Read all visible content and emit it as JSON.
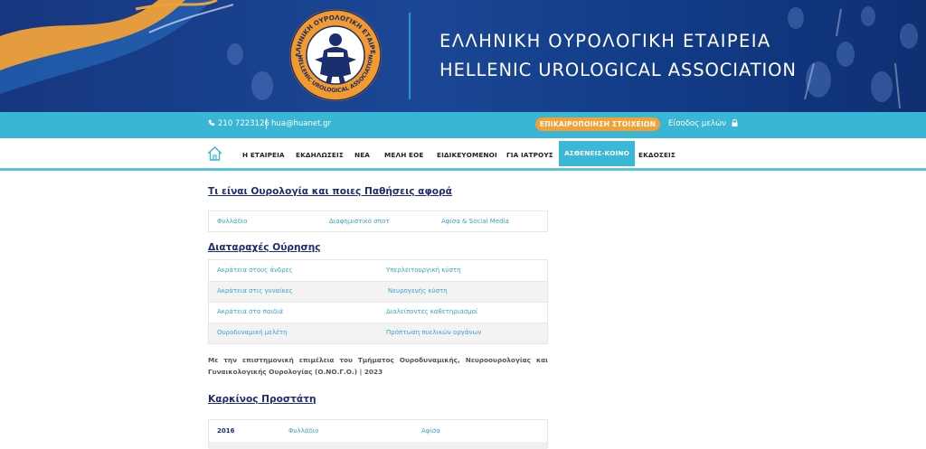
{
  "header": {
    "title_gr": "ΕΛΛΗΝΙΚΗ ΟΥΡΟΛΟΓΙΚΗ ΕΤΑΙΡΕΙΑ",
    "title_en": "HELLENIC UROLOGICAL ASSOCIATION",
    "logo_text_top": "ΕΛΛΗΝΙΚΗ ΟΥΡΟΛΟΓΙΚΗ ΕΤΑΙΡΕΙΑ",
    "logo_text_bottom": "HELLENIC UROLOGICAL ASSOCIATION"
  },
  "topbar": {
    "phone": "210 7223126",
    "email": "hua@huanet.gr",
    "update_button": "ΕΠΙΚΑΙΡΟΠΟΙΗΣΗ ΣΤΟΙΧΕΙΩΝ",
    "login": "Είσοδος μελών"
  },
  "nav": {
    "items": [
      "Η ΕΤΑΙΡΕΙΑ",
      "ΕΚΔΗΛΩΣΕΙΣ",
      "ΝΕΑ",
      "ΜΕΛΗ ΕΟΕ",
      "ΕΙΔΙΚΕΥΟΜΕΝΟΙ",
      "ΓΙΑ ΙΑΤΡΟΥΣ",
      "ΑΣΘΕΝΕΙΣ-ΚΟΙΝΟ",
      "ΕΚΔΟΣΕΙΣ"
    ],
    "active_index": 6
  },
  "section1": {
    "title": "Τι είναι Ουρολογία και ποιες Παθήσεις αφορά",
    "links": [
      "Φυλλάδιο",
      "Διαφημιστικό σποτ",
      "Αφίσα & Social Media"
    ]
  },
  "section2": {
    "title": "Διαταραχές Ούρησης",
    "rows": [
      [
        "Ακράτεια στους άνδρες",
        "Υπερλειτουργική κύστη"
      ],
      [
        "Ακράτεια στις γυναίκες",
        "Νευρογενής κύστη"
      ],
      [
        "Ακράτεια στα παιδιά",
        "Διαλείποντες καθετηριασμοί"
      ],
      [
        "Ουροδυναμική μελέτη",
        "Πρόπτωση πυελικών οργάνων"
      ]
    ],
    "note": "Με την επιστημονική επιμέλεια του Τμήματος Ουροδυναμικής, Νευροουρολογίας και Γυναικολογικής Ουρολογίας (Ο.ΝΟ.Γ.Ο.) | 2023"
  },
  "section3": {
    "title": "Καρκίνος Προστάτη",
    "rows": [
      {
        "year": "2016",
        "links": [
          "Φυλλάδιο",
          "Αφίσα"
        ]
      }
    ]
  },
  "colors": {
    "banner": "#1b4796",
    "strip": "#39b6d6",
    "accent": "#f5a033",
    "heading": "#1d2b78",
    "link": "#36a4cd"
  }
}
